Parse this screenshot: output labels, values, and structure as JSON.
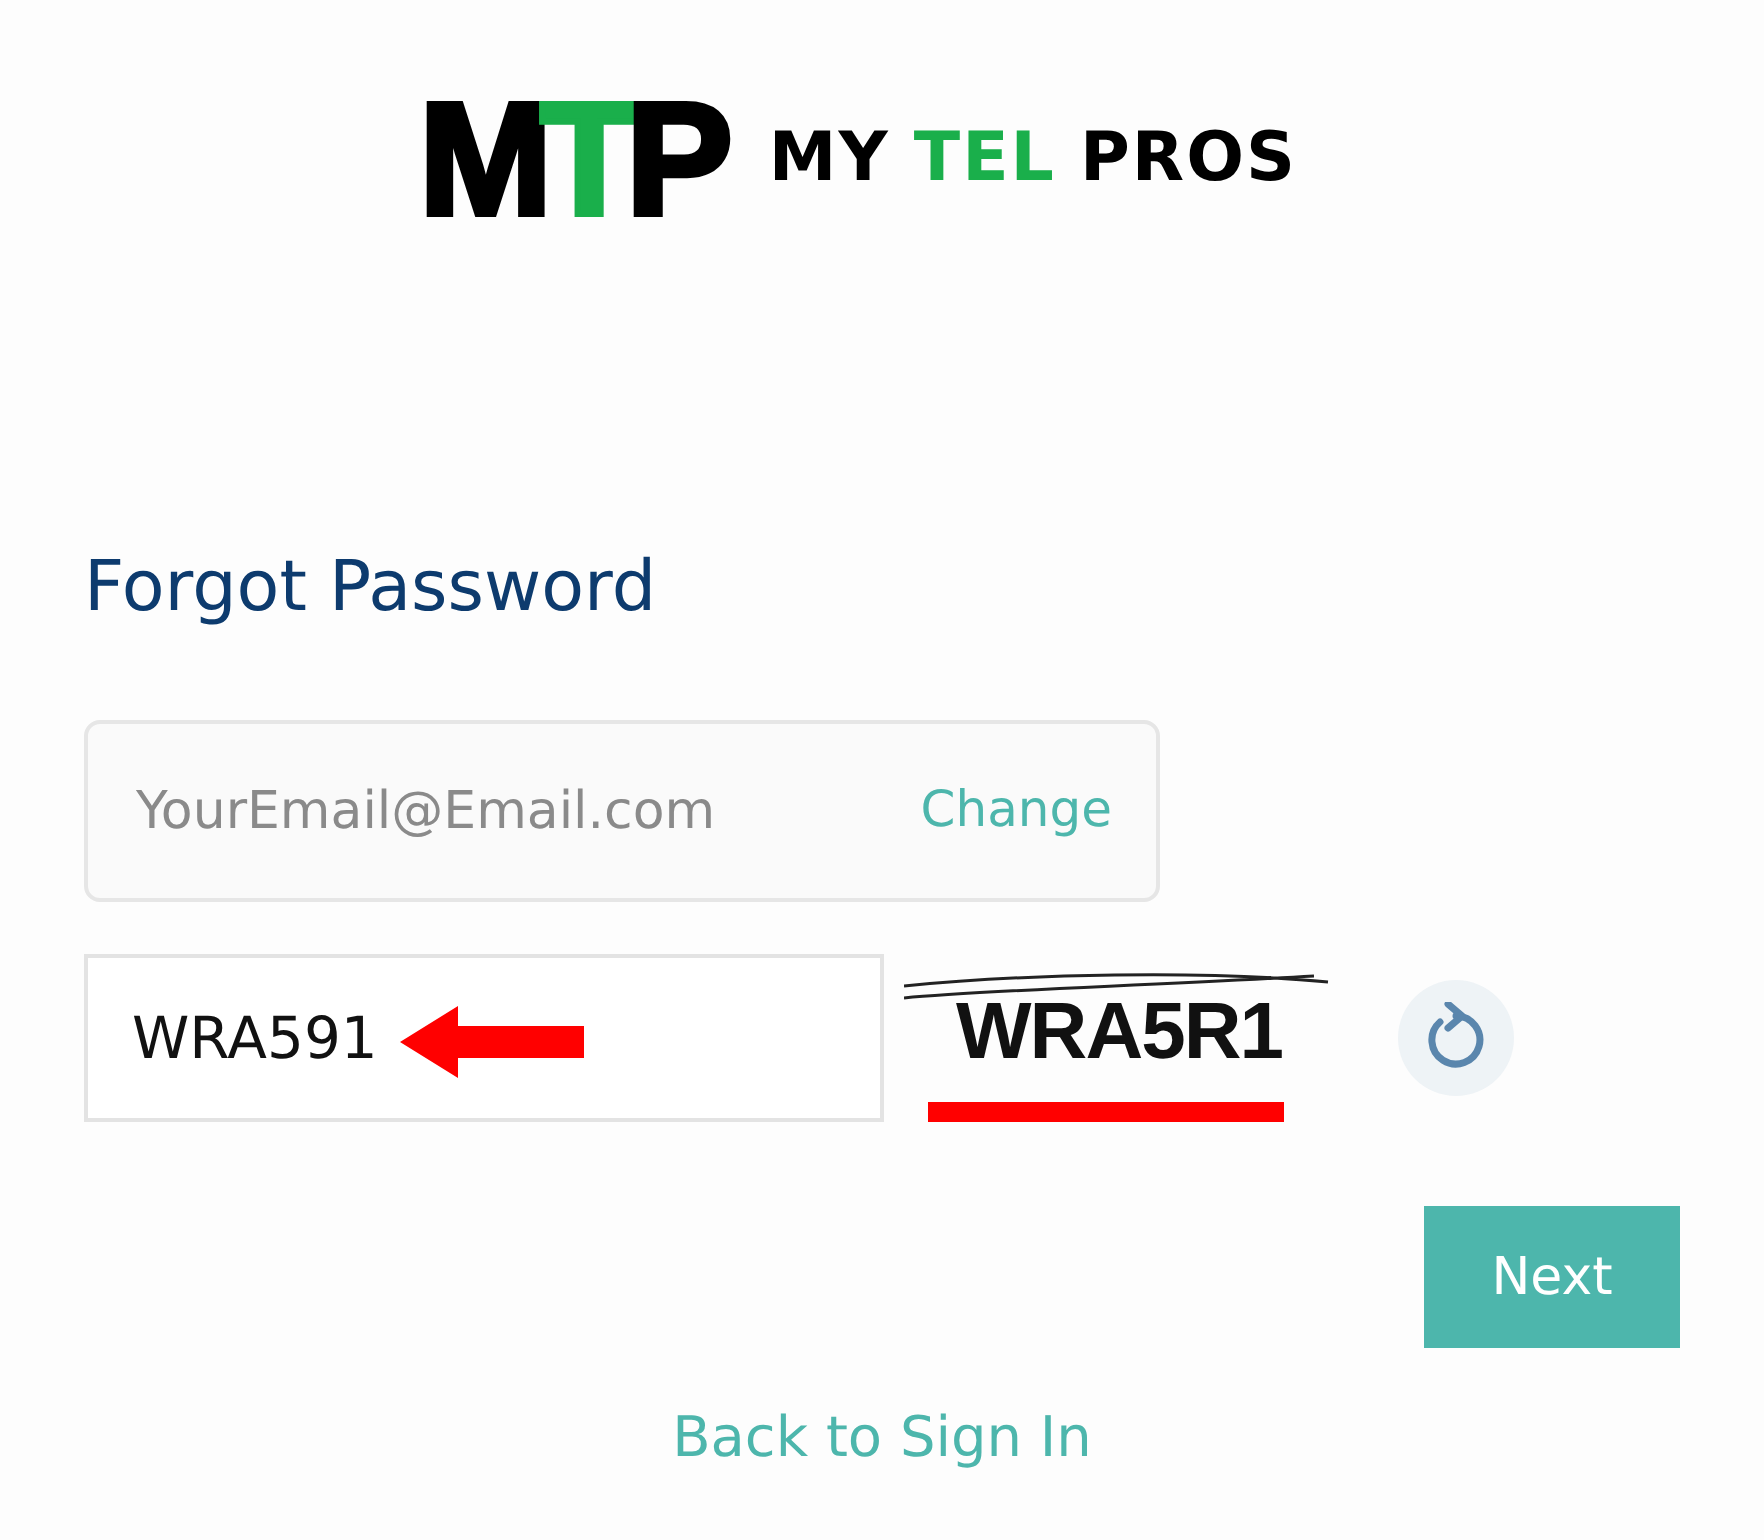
{
  "logo": {
    "mark": [
      {
        "text": "M",
        "color": "#000000"
      },
      {
        "text": "T",
        "color": "#1aaf4b"
      },
      {
        "text": "P",
        "color": "#000000"
      }
    ],
    "words": [
      {
        "text": "MY",
        "color": "#000000"
      },
      {
        "text": "TEL",
        "color": "#1aaf4b"
      },
      {
        "text": "PROS",
        "color": "#000000"
      }
    ]
  },
  "title": "Forgot Password",
  "email_field": {
    "placeholder": "YourEmail@Email.com",
    "action": "Change"
  },
  "captcha": {
    "value": "WRA591",
    "image_text": "WRA5R1"
  },
  "next_button": "Next",
  "back_link": "Back to Sign In"
}
